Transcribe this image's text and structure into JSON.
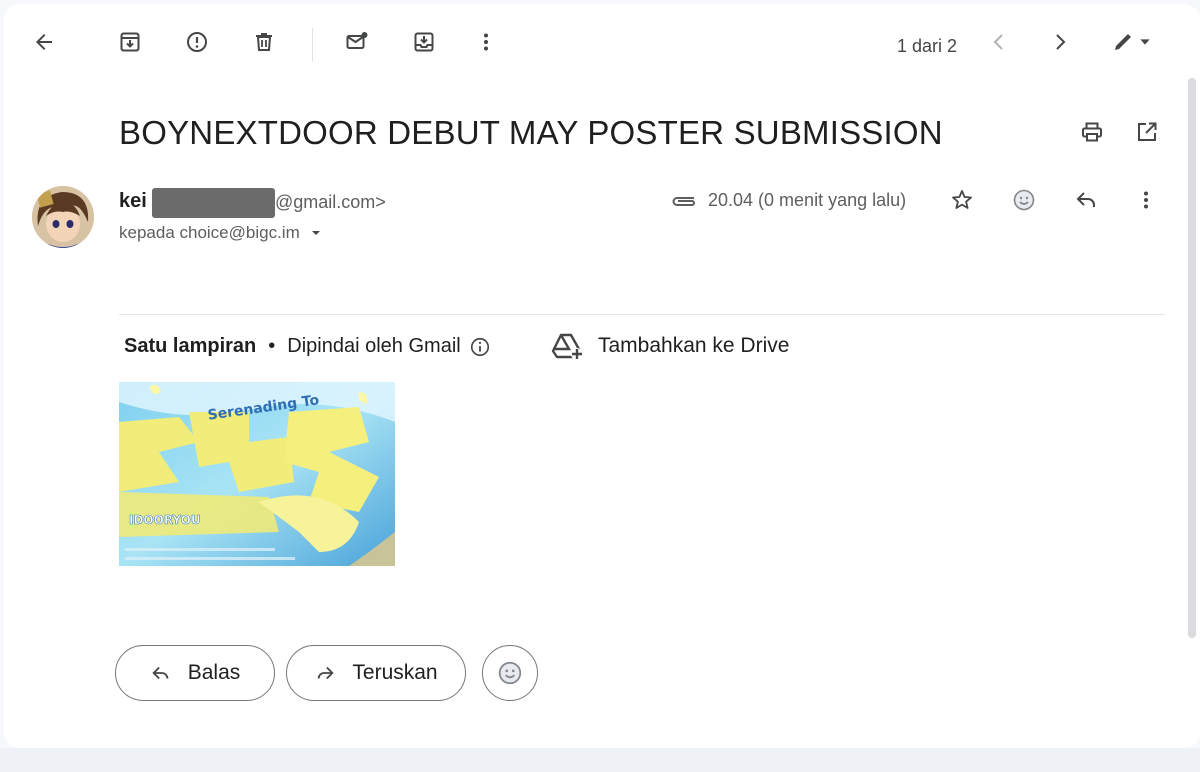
{
  "toolbar": {
    "icons": [
      "back-arrow-icon",
      "archive-icon",
      "report-spam-icon",
      "delete-icon",
      "mark-unread-icon",
      "move-to-icon",
      "more-vert-icon"
    ],
    "pager": "1 dari 2",
    "nav": [
      "chevron-left-icon",
      "chevron-right-icon",
      "pen-icon"
    ]
  },
  "email": {
    "subject": "BOYNEXTDOOR DEBUT MAY POSTER SUBMISSION",
    "sender_name": "kei",
    "sender_email": "@gmail.com>",
    "recipients": "kepada choice@bigc.im",
    "time": "20.04 (0 menit yang lalu)"
  },
  "attachments": {
    "title": "Satu lampiran",
    "scanned": "Dipindai oleh Gmail",
    "drive": "Tambahkan ke Drive",
    "thumbnail_text": [
      "Serenading To",
      "IDOORYOU"
    ]
  },
  "actions": {
    "reply": "Balas",
    "forward": "Teruskan"
  },
  "colors": {
    "icon": "#444746",
    "poster_yellow": "#f2ec7a",
    "poster_blue": "#5fb4e6"
  }
}
